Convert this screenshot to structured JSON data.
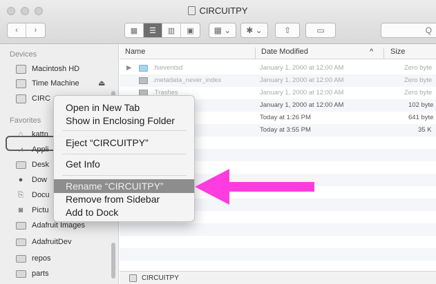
{
  "window": {
    "title": "CIRCUITPY",
    "search_glyph": "Q"
  },
  "toolbar": {
    "back_glyph": "‹",
    "forward_glyph": "›",
    "view_icons": [
      "icon-view-icon",
      "list-view-icon",
      "column-view-icon",
      "cover-flow-icon"
    ],
    "arrange_glyph": "▦ ⌄",
    "action_glyph": "✱ ⌄",
    "share_glyph": "⇧",
    "tag_glyph": "▭"
  },
  "sidebar": {
    "devices_header": "Devices",
    "devices": [
      {
        "label": "Macintosh HD",
        "icon": "hard-drive-icon"
      },
      {
        "label": "Time Machine",
        "icon": "time-machine-icon",
        "eject": "⏏"
      },
      {
        "label": "CIRC",
        "icon": "drive-icon"
      }
    ],
    "favorites_header": "Favorites",
    "favorites": [
      {
        "label": "kattn",
        "icon": "home-icon"
      },
      {
        "label": "Appli",
        "icon": "applications-icon"
      },
      {
        "label": "Desk",
        "icon": "folder-icon"
      },
      {
        "label": "Dow",
        "icon": "downloads-icon"
      },
      {
        "label": "Docu",
        "icon": "document-icon"
      },
      {
        "label": "Pictu",
        "icon": "camera-icon"
      },
      {
        "label": "Adafruit Images",
        "icon": "folder-icon"
      },
      {
        "label": "AdafruitDev",
        "icon": "folder-icon"
      },
      {
        "label": "repos",
        "icon": "folder-icon"
      },
      {
        "label": "parts",
        "icon": "folder-icon"
      }
    ]
  },
  "columns": {
    "name": "Name",
    "date": "Date Modified",
    "sort_glyph": "^",
    "size": "Size"
  },
  "files": [
    {
      "name": ".fseventsd",
      "date": "January 1, 2000 at 12:00 AM",
      "size": "Zero byte",
      "kind": "folder",
      "disclosure": "▶"
    },
    {
      "name": ".metadata_never_index",
      "date": "January 1, 2000 at 12:00 AM",
      "size": "Zero byte",
      "kind": "file"
    },
    {
      "name": ".Trashes",
      "date": "January 1, 2000 at 12:00 AM",
      "size": "Zero byte",
      "kind": "file"
    },
    {
      "name": "",
      "date": "January 1, 2000 at 12:00 AM",
      "size": "102 byte",
      "kind": "file"
    },
    {
      "name": "",
      "date": "Today at 1:26 PM",
      "size": "641 byte",
      "kind": "file"
    },
    {
      "name": "",
      "date": "Today at 3:55 PM",
      "size": "35 K",
      "kind": "file"
    }
  ],
  "context_menu": {
    "items": [
      {
        "label": "Open in New Tab"
      },
      {
        "label": "Show in Enclosing Folder"
      },
      {
        "label": "Eject “CIRCUITPY”"
      },
      {
        "label": "Get Info"
      },
      {
        "label": "Rename “CIRCUITPY”",
        "highlighted": true
      },
      {
        "label": "Remove from Sidebar"
      },
      {
        "label": "Add to Dock"
      }
    ]
  },
  "pathbar": {
    "label": "CIRCUITPY"
  },
  "colors": {
    "annotation_arrow": "#ff3ce0",
    "menu_highlight": "#8d8d8d"
  }
}
